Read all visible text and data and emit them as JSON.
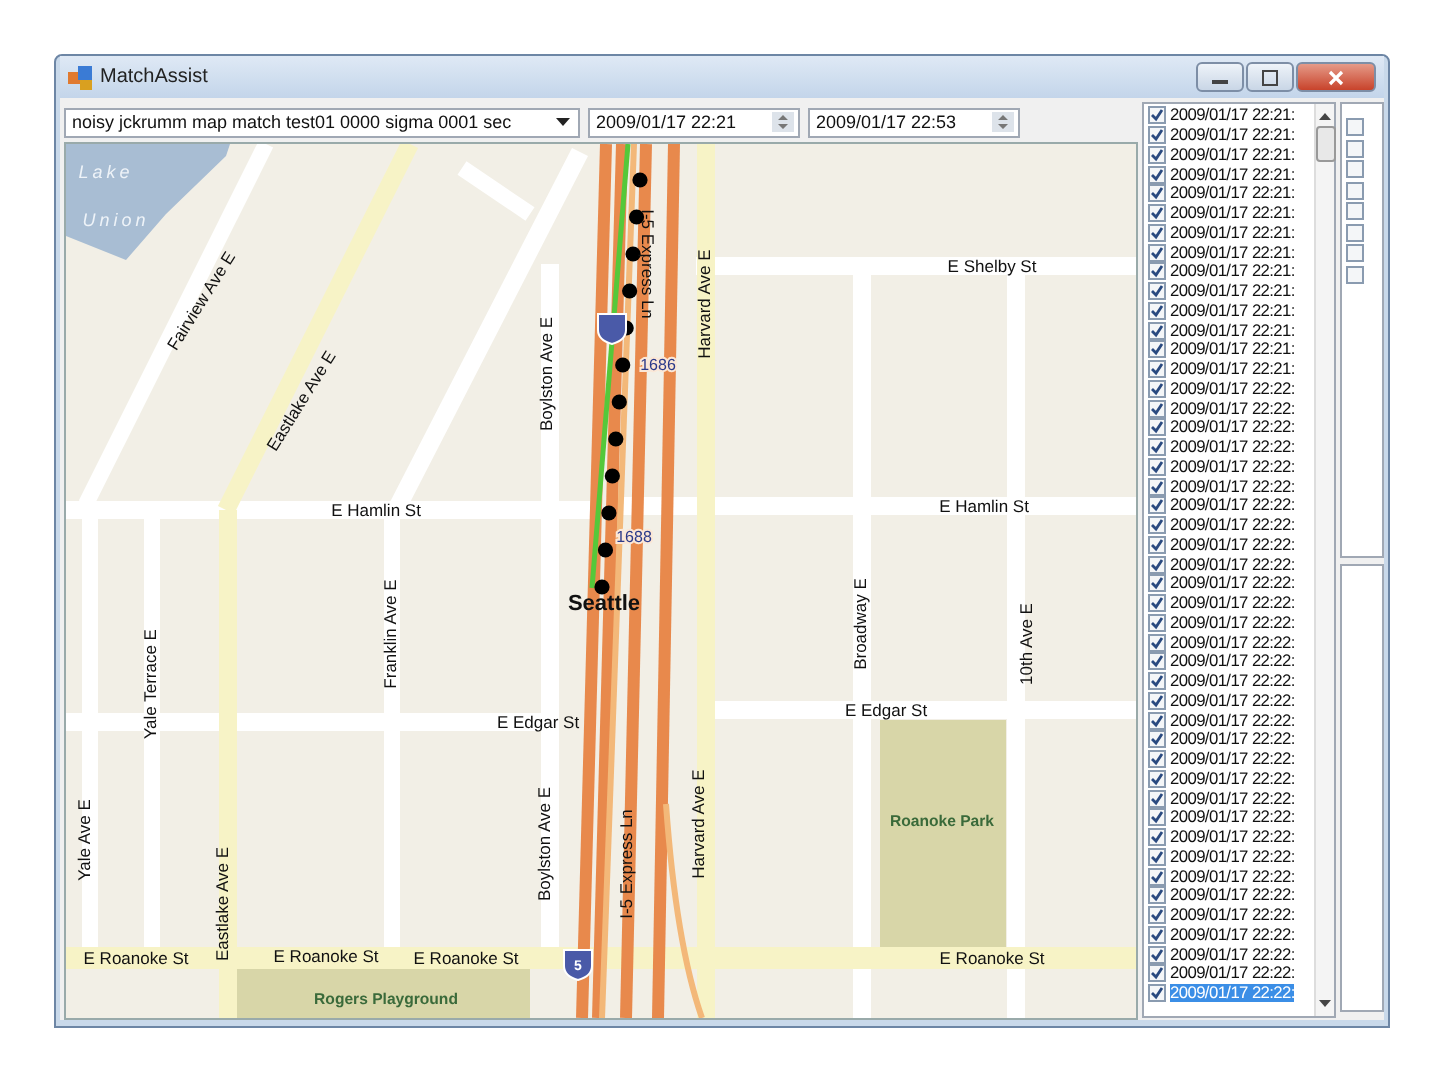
{
  "window": {
    "title": "MatchAssist"
  },
  "toolbar": {
    "dataset": "noisy jckrumm map match test01 0000 sigma 0001 sec",
    "start_time": "2009/01/17 22:21",
    "end_time": "2009/01/17 22:53"
  },
  "map": {
    "labels": [
      {
        "text": "Lake",
        "kind": "water"
      },
      {
        "text": "Union",
        "kind": "water"
      },
      {
        "text": "Fairview Ave E",
        "kind": "street"
      },
      {
        "text": "Eastlake Ave E",
        "kind": "street"
      },
      {
        "text": "Boylston Ave E",
        "kind": "street"
      },
      {
        "text": "I-5 Express Ln",
        "kind": "street"
      },
      {
        "text": "Harvard Ave E",
        "kind": "street"
      },
      {
        "text": "1686",
        "kind": "marker"
      },
      {
        "text": "E Shelby St",
        "kind": "street"
      },
      {
        "text": "E Hamlin St",
        "kind": "street"
      },
      {
        "text": "E Hamlin St",
        "kind": "street"
      },
      {
        "text": "1688",
        "kind": "marker"
      },
      {
        "text": "Seattle",
        "kind": "city"
      },
      {
        "text": "Broadway E",
        "kind": "street"
      },
      {
        "text": "10th Ave E",
        "kind": "street"
      },
      {
        "text": "Yale Terrace E",
        "kind": "street"
      },
      {
        "text": "Franklin Ave E",
        "kind": "street"
      },
      {
        "text": "E Edgar St",
        "kind": "street"
      },
      {
        "text": "E Edgar St",
        "kind": "street"
      },
      {
        "text": "Roanoke Park",
        "kind": "park"
      },
      {
        "text": "Boylston Ave E",
        "kind": "street"
      },
      {
        "text": "I-5 Express Ln",
        "kind": "street"
      },
      {
        "text": "Harvard Ave E",
        "kind": "street"
      },
      {
        "text": "Yale Ave E",
        "kind": "street"
      },
      {
        "text": "Eastlake Ave E",
        "kind": "street"
      },
      {
        "text": "E Roanoke St",
        "kind": "street"
      },
      {
        "text": "E Roanoke St",
        "kind": "street"
      },
      {
        "text": "E Roanoke St",
        "kind": "street"
      },
      {
        "text": "E Roanoke St",
        "kind": "street"
      },
      {
        "text": "Rogers Playground",
        "kind": "park"
      },
      {
        "text": "5",
        "kind": "shield"
      }
    ]
  },
  "points_list": {
    "rows": [
      {
        "text": "2009/01/17 22:21:",
        "checked": true,
        "selected": false
      },
      {
        "text": "2009/01/17 22:21:",
        "checked": true,
        "selected": false
      },
      {
        "text": "2009/01/17 22:21:",
        "checked": true,
        "selected": false
      },
      {
        "text": "2009/01/17 22:21:",
        "checked": true,
        "selected": false
      },
      {
        "text": "2009/01/17 22:21:",
        "checked": true,
        "selected": false
      },
      {
        "text": "2009/01/17 22:21:",
        "checked": true,
        "selected": false
      },
      {
        "text": "2009/01/17 22:21:",
        "checked": true,
        "selected": false
      },
      {
        "text": "2009/01/17 22:21:",
        "checked": true,
        "selected": false
      },
      {
        "text": "2009/01/17 22:21:",
        "checked": true,
        "selected": false
      },
      {
        "text": "2009/01/17 22:21:",
        "checked": true,
        "selected": false
      },
      {
        "text": "2009/01/17 22:21:",
        "checked": true,
        "selected": false
      },
      {
        "text": "2009/01/17 22:21:",
        "checked": true,
        "selected": false
      },
      {
        "text": "2009/01/17 22:21:",
        "checked": true,
        "selected": false
      },
      {
        "text": "2009/01/17 22:21:",
        "checked": true,
        "selected": false
      },
      {
        "text": "2009/01/17 22:22:",
        "checked": true,
        "selected": false
      },
      {
        "text": "2009/01/17 22:22:",
        "checked": true,
        "selected": false
      },
      {
        "text": "2009/01/17 22:22:",
        "checked": true,
        "selected": false
      },
      {
        "text": "2009/01/17 22:22:",
        "checked": true,
        "selected": false
      },
      {
        "text": "2009/01/17 22:22:",
        "checked": true,
        "selected": false
      },
      {
        "text": "2009/01/17 22:22:",
        "checked": true,
        "selected": false
      },
      {
        "text": "2009/01/17 22:22:",
        "checked": true,
        "selected": false
      },
      {
        "text": "2009/01/17 22:22:",
        "checked": true,
        "selected": false
      },
      {
        "text": "2009/01/17 22:22:",
        "checked": true,
        "selected": false
      },
      {
        "text": "2009/01/17 22:22:",
        "checked": true,
        "selected": false
      },
      {
        "text": "2009/01/17 22:22:",
        "checked": true,
        "selected": false
      },
      {
        "text": "2009/01/17 22:22:",
        "checked": true,
        "selected": false
      },
      {
        "text": "2009/01/17 22:22:",
        "checked": true,
        "selected": false
      },
      {
        "text": "2009/01/17 22:22:",
        "checked": true,
        "selected": false
      },
      {
        "text": "2009/01/17 22:22:",
        "checked": true,
        "selected": false
      },
      {
        "text": "2009/01/17 22:22:",
        "checked": true,
        "selected": false
      },
      {
        "text": "2009/01/17 22:22:",
        "checked": true,
        "selected": false
      },
      {
        "text": "2009/01/17 22:22:",
        "checked": true,
        "selected": false
      },
      {
        "text": "2009/01/17 22:22:",
        "checked": true,
        "selected": false
      },
      {
        "text": "2009/01/17 22:22:",
        "checked": true,
        "selected": false
      },
      {
        "text": "2009/01/17 22:22:",
        "checked": true,
        "selected": false
      },
      {
        "text": "2009/01/17 22:22:",
        "checked": true,
        "selected": false
      },
      {
        "text": "2009/01/17 22:22:",
        "checked": true,
        "selected": false
      },
      {
        "text": "2009/01/17 22:22:",
        "checked": true,
        "selected": false
      },
      {
        "text": "2009/01/17 22:22:",
        "checked": true,
        "selected": false
      },
      {
        "text": "2009/01/17 22:22:",
        "checked": true,
        "selected": false
      },
      {
        "text": "2009/01/17 22:22:",
        "checked": true,
        "selected": false
      },
      {
        "text": "2009/01/17 22:22:",
        "checked": true,
        "selected": false
      },
      {
        "text": "2009/01/17 22:22:",
        "checked": true,
        "selected": false
      },
      {
        "text": "2009/01/17 22:22:",
        "checked": true,
        "selected": false
      },
      {
        "text": "2009/01/17 22:22:",
        "checked": true,
        "selected": false
      },
      {
        "text": "2009/01/17 22:22:",
        "checked": true,
        "selected": true
      }
    ]
  },
  "layers_list": {
    "items": [
      {
        "checked": false
      },
      {
        "checked": false
      },
      {
        "checked": false
      },
      {
        "checked": false
      },
      {
        "checked": false
      },
      {
        "checked": false
      },
      {
        "checked": false
      },
      {
        "checked": false
      }
    ]
  }
}
